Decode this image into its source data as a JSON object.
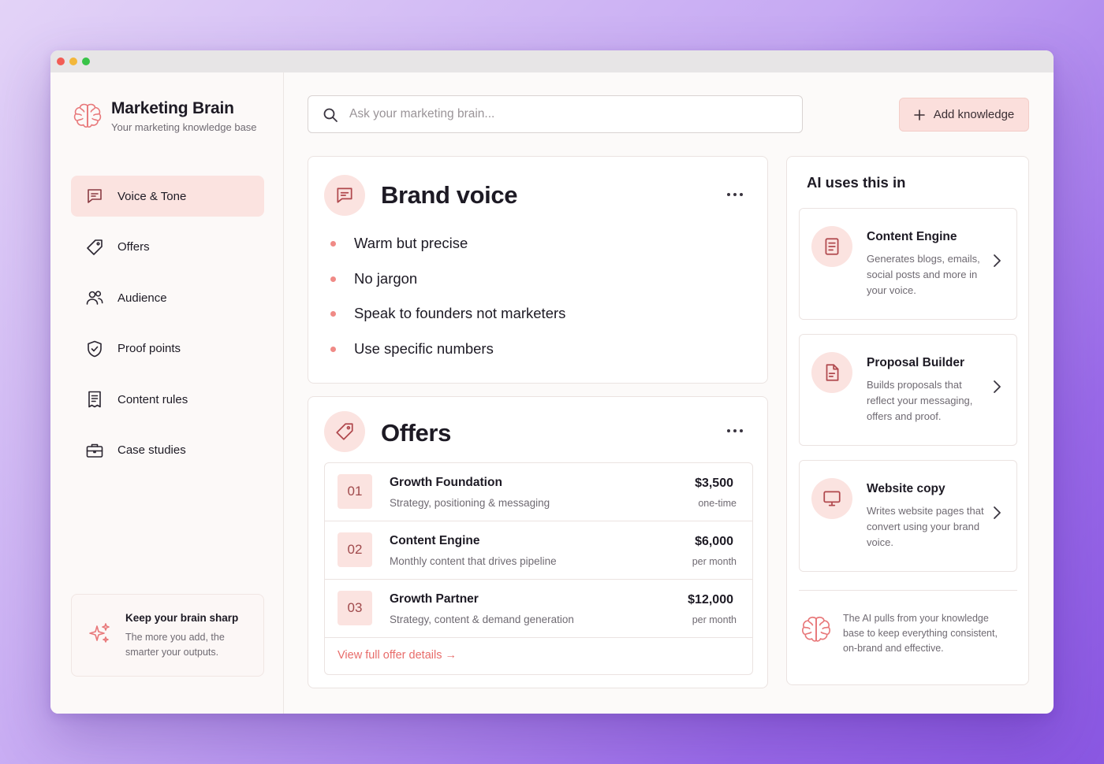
{
  "app": {
    "title": "Marketing Brain",
    "subtitle": "Your marketing knowledge base"
  },
  "colors": {
    "accent": "#e86c6a",
    "accent_soft": "#fbe3e0",
    "text": "#1d1a24",
    "muted": "#6f6a72"
  },
  "sidebar": {
    "items": [
      {
        "label": "Voice & Tone",
        "icon": "chat-icon",
        "active": true
      },
      {
        "label": "Offers",
        "icon": "tag-icon",
        "active": false
      },
      {
        "label": "Audience",
        "icon": "users-icon",
        "active": false
      },
      {
        "label": "Proof points",
        "icon": "shield-check-icon",
        "active": false
      },
      {
        "label": "Content rules",
        "icon": "receipt-icon",
        "active": false
      },
      {
        "label": "Case studies",
        "icon": "briefcase-icon",
        "active": false
      }
    ],
    "tip": {
      "title": "Keep your brain sharp",
      "text": "The more you add, the smarter your outputs."
    }
  },
  "search": {
    "placeholder": "Ask your marketing brain...",
    "value": ""
  },
  "add_button": {
    "label": "Add knowledge"
  },
  "brand_voice": {
    "title": "Brand voice",
    "bullets": [
      "Warm but precise",
      "No jargon",
      "Speak to founders not marketers",
      "Use specific numbers"
    ]
  },
  "offers": {
    "title": "Offers",
    "rows": [
      {
        "num": "01",
        "name": "Growth Foundation",
        "desc": "Strategy, positioning & messaging",
        "price": "$3,500",
        "unit": "one-time"
      },
      {
        "num": "02",
        "name": "Content Engine",
        "desc": "Monthly content that drives pipeline",
        "price": "$6,000",
        "unit": "per month"
      },
      {
        "num": "03",
        "name": "Growth Partner",
        "desc": "Strategy, content & demand generation",
        "price": "$12,000",
        "unit": "per month"
      }
    ],
    "link": "View full offer details →"
  },
  "ai_panel": {
    "title": "AI uses this in",
    "items": [
      {
        "name": "Content Engine",
        "desc": "Generates blogs, emails, social posts and more in your voice.",
        "icon": "document-icon"
      },
      {
        "name": "Proposal Builder",
        "desc": "Builds proposals that reflect your messaging, offers and proof.",
        "icon": "file-icon"
      },
      {
        "name": "Website copy",
        "desc": "Writes website pages that convert using your brand voice.",
        "icon": "monitor-icon"
      }
    ],
    "note": "The AI pulls from your knowledge base to keep everything consistent, on-brand and effective."
  }
}
